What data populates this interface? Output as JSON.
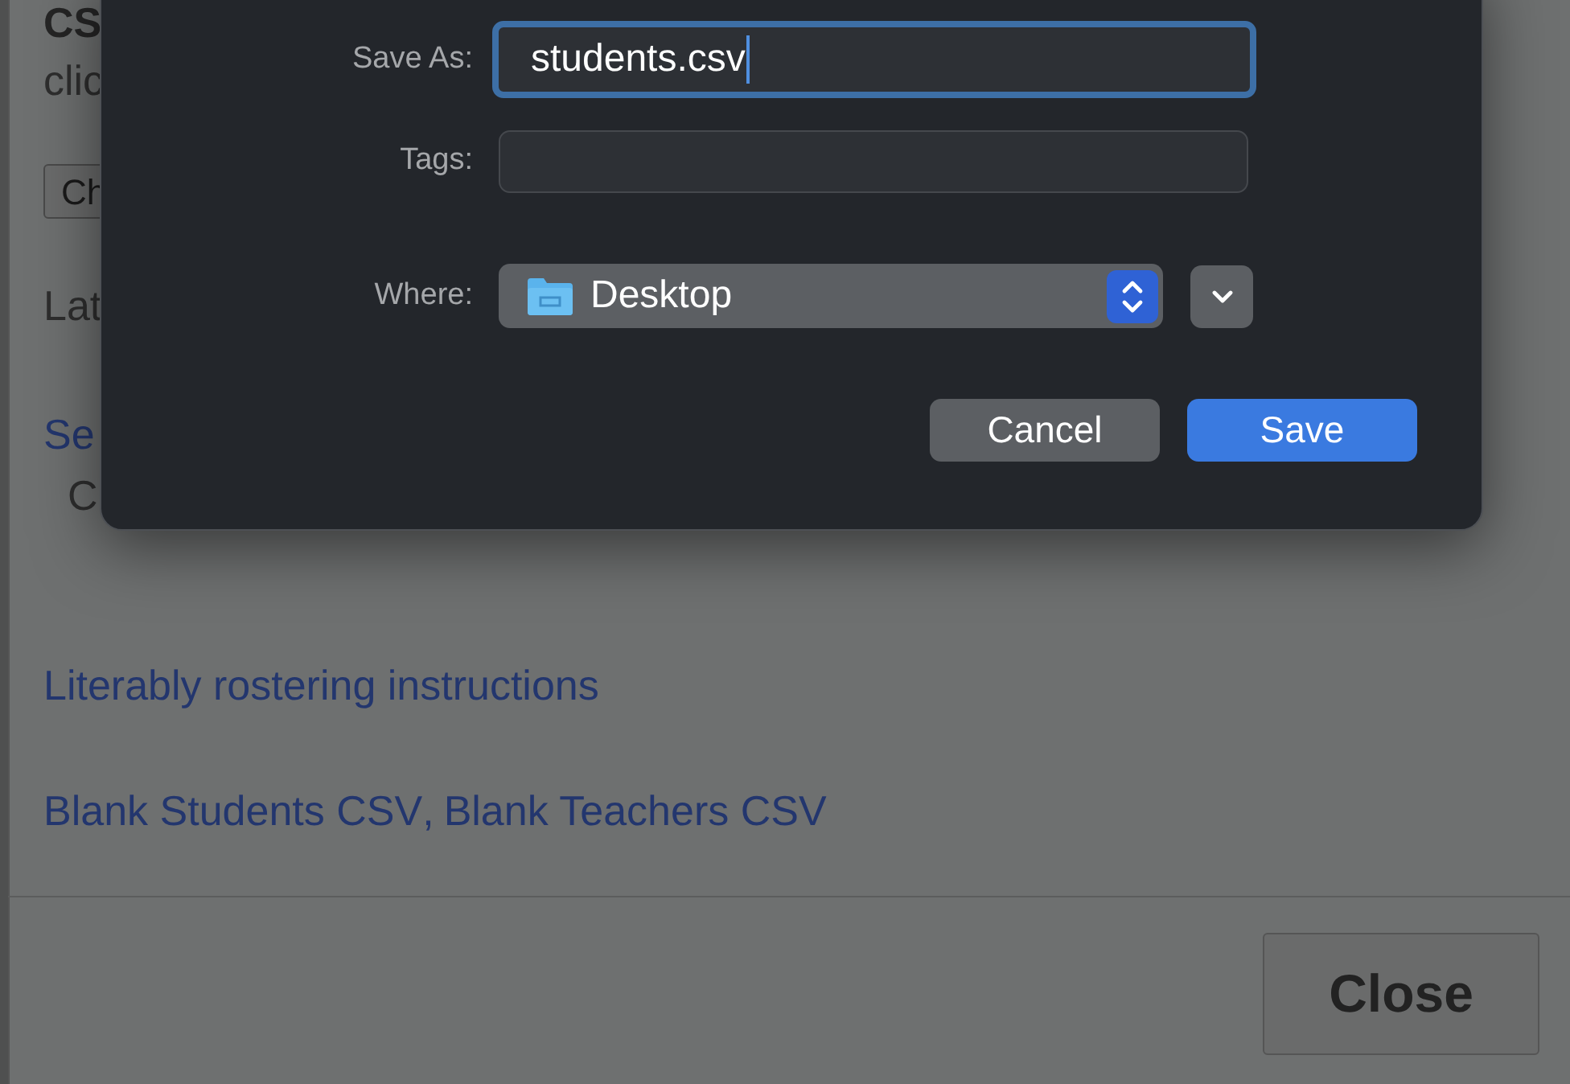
{
  "page": {
    "heading": "CS",
    "text_1": "clic",
    "button": "Ch",
    "text_2": "Lat",
    "link": "Se",
    "text_3": "C",
    "instructions_link": "Literably rostering instructions",
    "blank_links": [
      "Blank Students CSV",
      "Blank Teachers CSV"
    ],
    "separator": ",",
    "close_button": "Close"
  },
  "save_dialog": {
    "fields": [
      {
        "label": "Save As:",
        "value": "students.csv",
        "focused": true
      },
      {
        "label": "Tags:",
        "focused": false
      }
    ],
    "where": {
      "label": "Where:",
      "location": "Desktop"
    },
    "buttons": [
      {
        "label": "Cancel",
        "kind": "normal"
      },
      {
        "label": "Save",
        "kind": "default"
      }
    ]
  }
}
